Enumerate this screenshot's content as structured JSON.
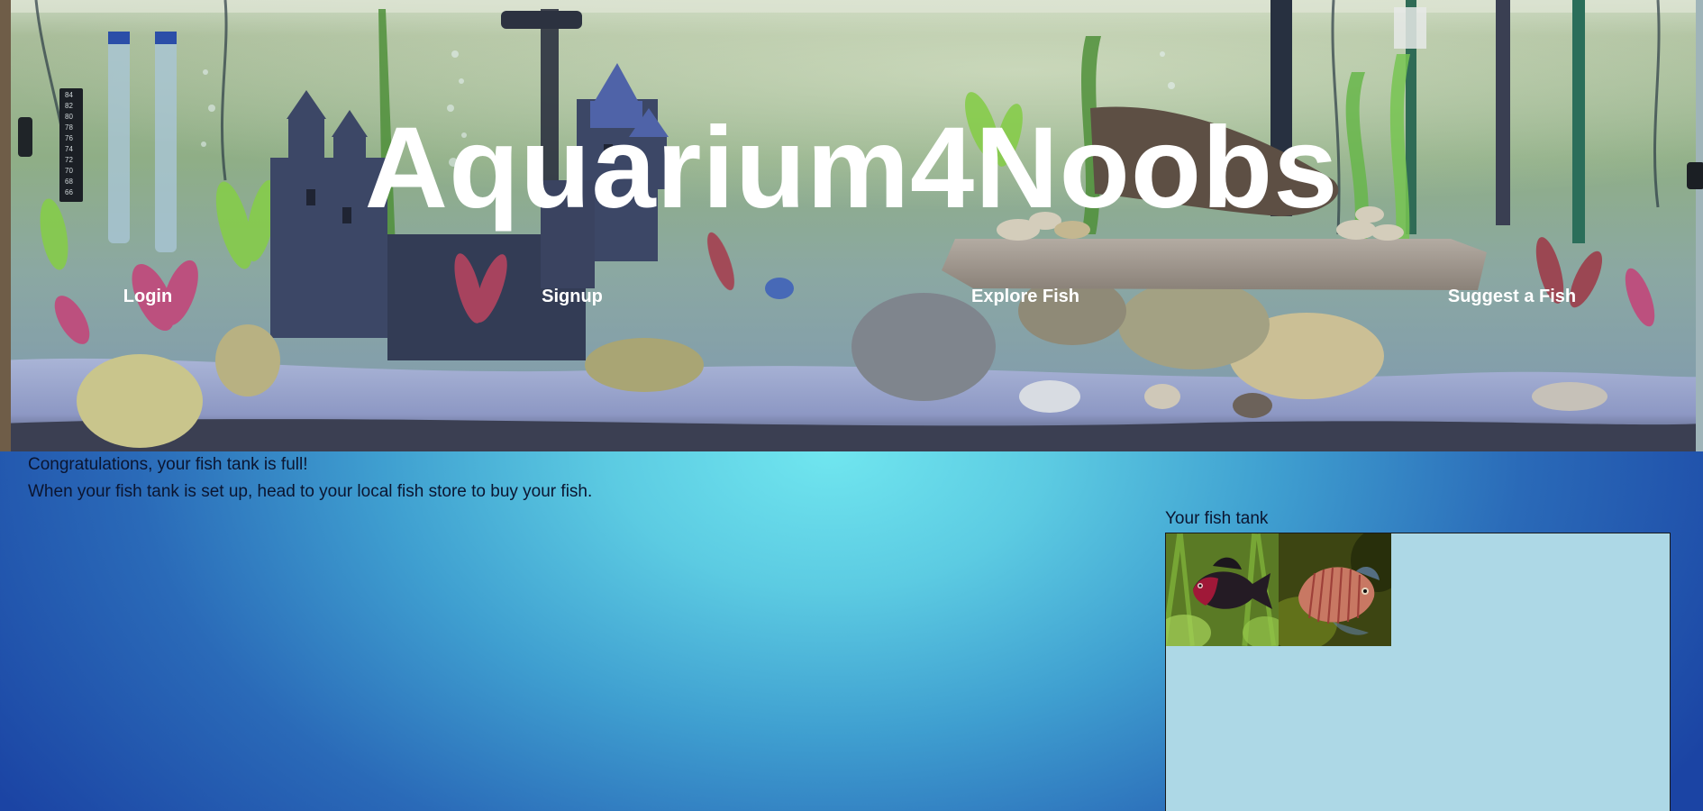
{
  "site": {
    "title": "Aquarium4Noobs"
  },
  "nav": {
    "items": [
      {
        "label": "Login"
      },
      {
        "label": "Signup"
      },
      {
        "label": "Explore Fish"
      },
      {
        "label": "Suggest a Fish"
      }
    ]
  },
  "main": {
    "message_full": "Congratulations, your fish tank is full!",
    "message_store": "When your fish tank is set up, head to your local fish store to buy your fish.",
    "tank_label": "Your fish tank",
    "tank_fish": [
      {
        "icon": "black-ruby-barb-fish-photo"
      },
      {
        "icon": "dwarf-gourami-fish-photo"
      }
    ]
  },
  "colors": {
    "tank_background": "#add8e6",
    "title_text": "#ffffff",
    "nav_text": "#ffffff",
    "body_text": "#0b1530"
  }
}
